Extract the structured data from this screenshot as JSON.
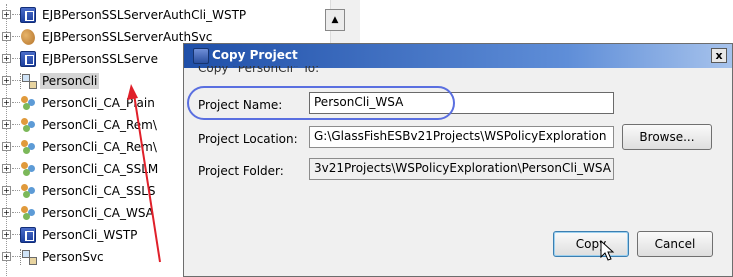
{
  "tree": {
    "items": [
      {
        "label": "EJBPersonSSLServerAuthCli_WSTP",
        "icon": "project-icon"
      },
      {
        "label": "EJBPersonSSLServerAuthSvc",
        "icon": "ejb-bean-icon"
      },
      {
        "label": "EJBPersonSSLServe",
        "icon": "project-icon"
      },
      {
        "label": "PersonCli",
        "icon": "web-app-icon"
      },
      {
        "label": "PersonCli_CA_Plain",
        "icon": "composite-app-icon"
      },
      {
        "label": "PersonCli_CA_Rem\\",
        "icon": "composite-app-icon"
      },
      {
        "label": "PersonCli_CA_Rem\\",
        "icon": "composite-app-icon"
      },
      {
        "label": "PersonCli_CA_SSLM",
        "icon": "composite-app-icon"
      },
      {
        "label": "PersonCli_CA_SSLS",
        "icon": "composite-app-icon"
      },
      {
        "label": "PersonCli_CA_WSA",
        "icon": "composite-app-icon"
      },
      {
        "label": "PersonCli_WSTP",
        "icon": "project-icon"
      },
      {
        "label": "PersonSvc",
        "icon": "web-app-icon"
      }
    ],
    "expander": "+",
    "scroll_up": "▲"
  },
  "dialog": {
    "title": "Copy Project",
    "close": "x",
    "subtitle": "Copy \"PersonCli\" To:",
    "project_name_label": "Project Name:",
    "project_name_value": "PersonCli_WSA",
    "project_location_label": "Project Location:",
    "project_location_value": "G:\\GlassFishESBv21Projects\\WSPolicyExploration",
    "project_folder_label": "Project Folder:",
    "project_folder_value": "3v21Projects\\WSPolicyExploration\\PersonCli_WSA",
    "browse_label": "Browse...",
    "copy_label": "Copy",
    "cancel_label": "Cancel"
  },
  "colors": {
    "annotation_arrow": "#e0202a",
    "annotation_oval": "#5a6fe0",
    "titlebar_start": "#1f4fa8"
  }
}
